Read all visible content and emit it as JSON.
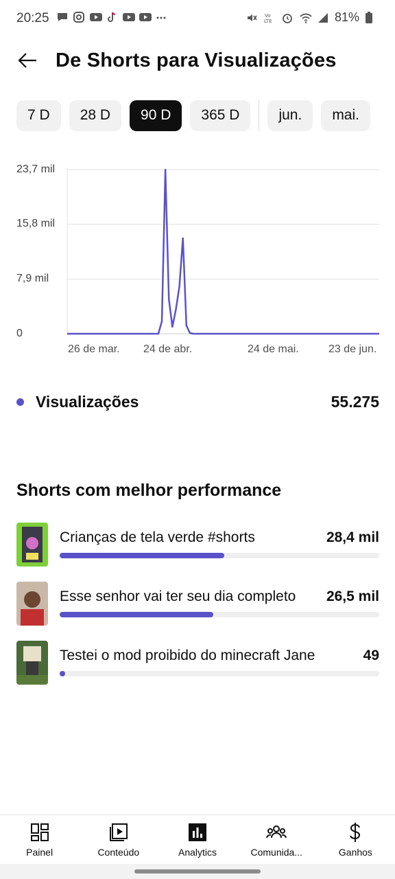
{
  "status_bar": {
    "time": "20:25",
    "battery": "81%",
    "left_icons": [
      "message-icon",
      "instagram-icon",
      "youtube-icon",
      "tiktok-icon",
      "youtube-icon",
      "youtube-icon",
      "more-dots-icon"
    ],
    "right_icons": [
      "mute-icon",
      "volte-icon",
      "alarm-icon",
      "wifi-icon",
      "signal-icon",
      "battery-icon"
    ]
  },
  "header": {
    "title": "De Shorts para Visualizações",
    "back_icon": "arrow-left-icon"
  },
  "chips": [
    {
      "label": "7 D",
      "active": false
    },
    {
      "label": "28 D",
      "active": false
    },
    {
      "label": "90 D",
      "active": true
    },
    {
      "label": "365 D",
      "active": false
    },
    {
      "label": "jun.",
      "active": false
    },
    {
      "label": "mai.",
      "active": false
    }
  ],
  "chart_data": {
    "type": "line",
    "y_ticks": [
      "23,7 mil",
      "15,8 mil",
      "7,9 mil",
      "0"
    ],
    "ylim": [
      0,
      23700
    ],
    "x_ticks": [
      "26 de mar.",
      "24 de abr.",
      "24 de mai.",
      "23 de jun."
    ],
    "x_tick_days": [
      0,
      29,
      59,
      89
    ],
    "xlim": [
      0,
      89
    ],
    "series": [
      {
        "color": "#5a52c9",
        "points": [
          [
            0,
            0
          ],
          [
            26,
            0
          ],
          [
            27,
            1800
          ],
          [
            28,
            23700
          ],
          [
            29,
            5000
          ],
          [
            30,
            1000
          ],
          [
            31,
            3500
          ],
          [
            32,
            6800
          ],
          [
            33,
            13800
          ],
          [
            34,
            1200
          ],
          [
            35,
            100
          ],
          [
            36,
            0
          ],
          [
            89,
            0
          ]
        ]
      }
    ]
  },
  "metric": {
    "label": "Visualizações",
    "value": "55.275",
    "color": "#5a52c9"
  },
  "top_shorts": {
    "title": "Shorts com melhor performance",
    "items": [
      {
        "title": "Crianças de tela verde #shorts",
        "value": "28,4 mil",
        "fraction": 1.0
      },
      {
        "title": "Esse senhor vai ter seu dia completo",
        "value": "26,5 mil",
        "fraction": 0.933
      },
      {
        "title": "Testei o mod proibido do minecraft Jane",
        "value": "49",
        "fraction": 0.002
      }
    ]
  },
  "bottom_nav": [
    {
      "label": "Painel",
      "icon": "dashboard-icon"
    },
    {
      "label": "Conteúdo",
      "icon": "content-icon"
    },
    {
      "label": "Analytics",
      "icon": "analytics-icon",
      "active": true
    },
    {
      "label": "Comunida...",
      "icon": "community-icon"
    },
    {
      "label": "Ganhos",
      "icon": "dollar-icon"
    }
  ]
}
